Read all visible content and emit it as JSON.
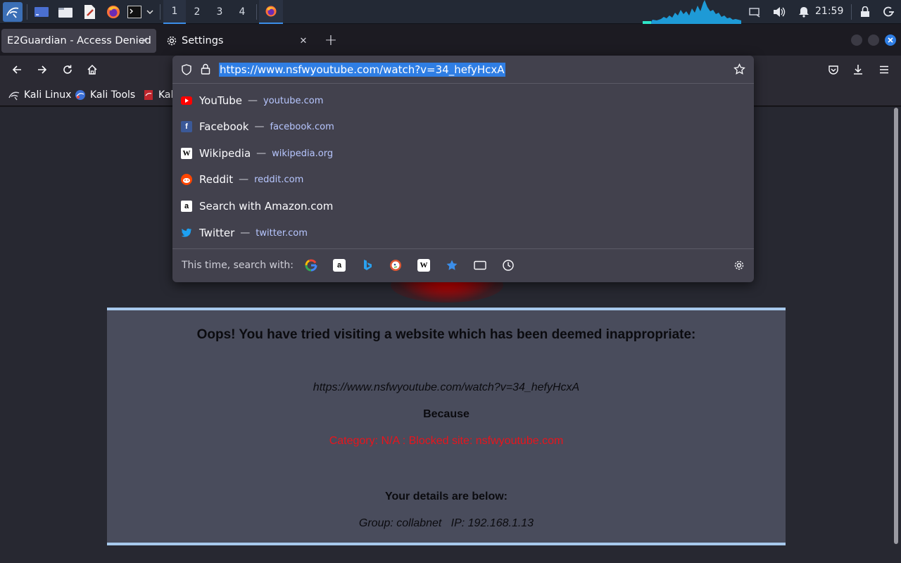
{
  "taskbar": {
    "workspaces": [
      "1",
      "2",
      "3",
      "4"
    ],
    "clock": "21:59"
  },
  "tabs": [
    {
      "label": "E2Guardian - Access Denied",
      "active": true
    },
    {
      "label": "Settings",
      "active": false
    }
  ],
  "urlbar": {
    "value": "https://www.nsfwyoutube.com/watch?v=34_hefyHcxA"
  },
  "suggestions": [
    {
      "title": "YouTube",
      "domain": "youtube.com",
      "icon": "youtube-icon"
    },
    {
      "title": "Facebook",
      "domain": "facebook.com",
      "icon": "facebook-icon"
    },
    {
      "title": "Wikipedia",
      "domain": "wikipedia.org",
      "icon": "wikipedia-icon"
    },
    {
      "title": "Reddit",
      "domain": "reddit.com",
      "icon": "reddit-icon"
    },
    {
      "title": "Search with Amazon.com",
      "domain": "",
      "icon": "amazon-icon"
    },
    {
      "title": "Twitter",
      "domain": "twitter.com",
      "icon": "twitter-icon"
    }
  ],
  "suggestion_separator": "—",
  "oneoff": {
    "label": "This time, search with:",
    "engines": [
      "google-icon",
      "amazon-icon",
      "bing-icon",
      "duckduckgo-icon",
      "wikipedia-icon",
      "bookmarks-icon",
      "tabs-icon",
      "history-icon"
    ]
  },
  "bookmarks": [
    {
      "label": "Kali Linux",
      "icon": "kali-dragon-icon"
    },
    {
      "label": "Kali Tools",
      "icon": "kali-tools-icon"
    },
    {
      "label": "Kali",
      "icon": "kali-docs-icon"
    }
  ],
  "page": {
    "headline": "Oops! You have tried visiting a website which has been deemed inappropriate:",
    "blocked_url": "https://www.nsfwyoutube.com/watch?v=34_hefyHcxA",
    "because": "Because",
    "reason": "Category: N/A : Blocked site: nsfwyoutube.com",
    "details_heading": "Your details are below:",
    "details": "Group: collabnet   IP: 192.168.1.13"
  },
  "colors": {
    "accent": "#2f7ee4",
    "panel_border": "#a7c9ec",
    "reason_red": "#e8141c"
  }
}
